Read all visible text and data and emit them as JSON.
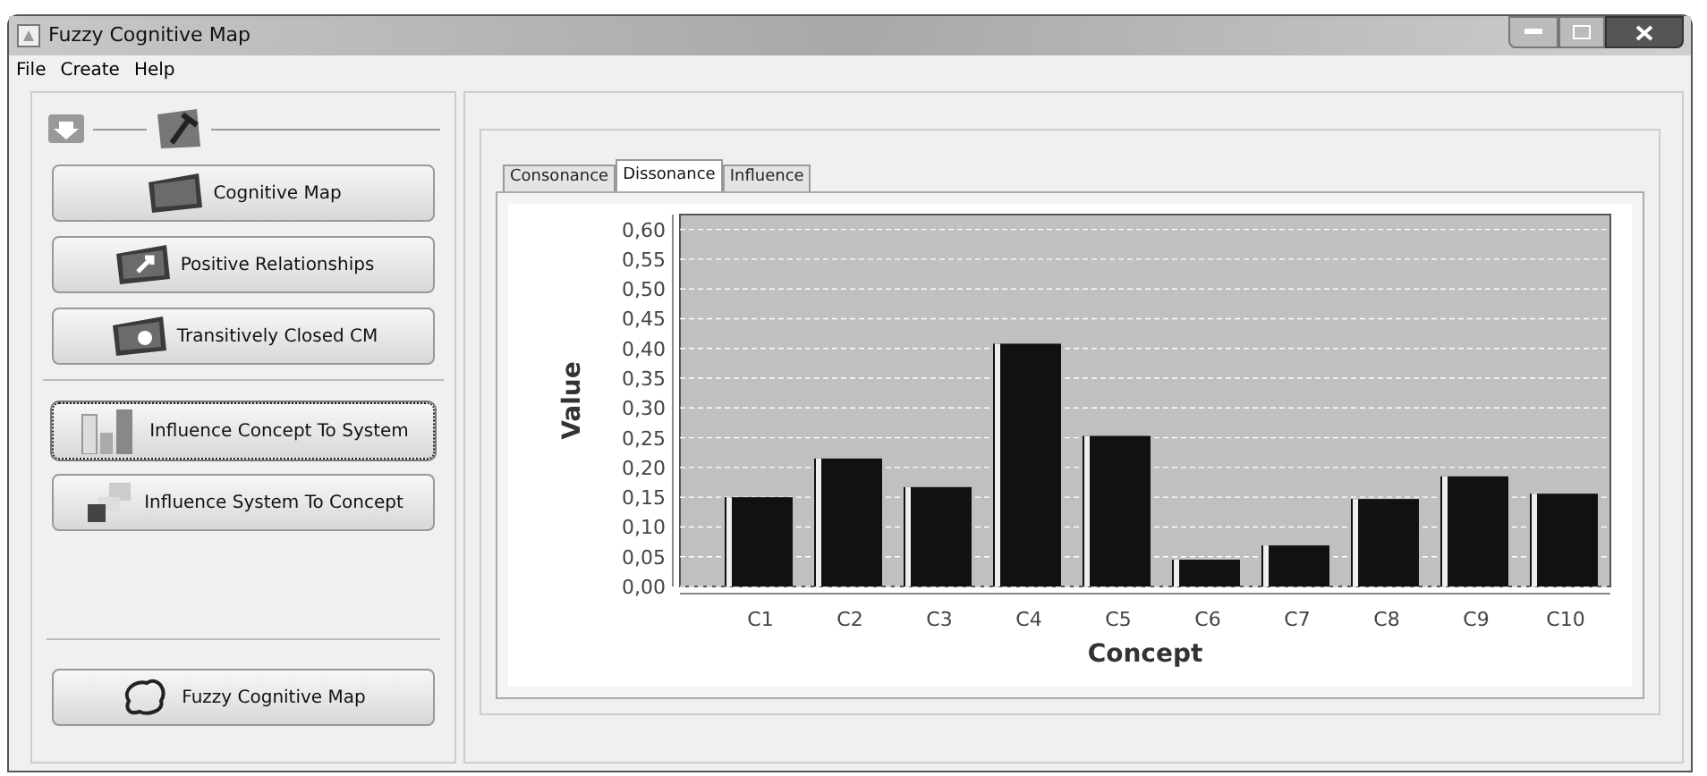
{
  "window": {
    "title": "Fuzzy Cognitive Map"
  },
  "menu": [
    "File",
    "Create",
    "Help"
  ],
  "sidebar": {
    "buttons": [
      {
        "label": "Cognitive Map",
        "kind": "map",
        "selected": false
      },
      {
        "label": "Positive Relationships",
        "kind": "positive",
        "selected": false
      },
      {
        "label": "Transitively Closed CM",
        "kind": "closed",
        "selected": false
      },
      {
        "label": "Influence Concept To System",
        "kind": "bars",
        "selected": true
      },
      {
        "label": "Influence System To Concept",
        "kind": "cubes",
        "selected": false
      }
    ],
    "footer_button": {
      "label": "Fuzzy Cognitive Map"
    }
  },
  "tabs": [
    {
      "label": "Consonance",
      "selected": false
    },
    {
      "label": "Dissonance",
      "selected": true
    },
    {
      "label": "Influence",
      "selected": false
    }
  ],
  "chart_data": {
    "type": "bar",
    "xlabel": "Concept",
    "ylabel": "Value",
    "categories": [
      "C1",
      "C2",
      "C3",
      "C4",
      "C5",
      "C6",
      "C7",
      "C8",
      "C9",
      "C10"
    ],
    "grid": true,
    "series": [
      {
        "color": "#111111",
        "values": [
          0.15,
          0.215,
          0.167,
          0.408,
          0.253,
          0.045,
          0.069,
          0.147,
          0.185,
          0.156
        ]
      }
    ],
    "ylim": [
      0,
      0.625
    ],
    "yticks": [
      {
        "value": 0,
        "label": "0,00"
      },
      {
        "value": 0.05,
        "label": "0,05"
      },
      {
        "value": 0.1,
        "label": "0,10"
      },
      {
        "value": 0.15,
        "label": "0,15"
      },
      {
        "value": 0.2,
        "label": "0,20"
      },
      {
        "value": 0.25,
        "label": "0,25"
      },
      {
        "value": 0.3,
        "label": "0,30"
      },
      {
        "value": 0.35,
        "label": "0,35"
      },
      {
        "value": 0.4,
        "label": "0,40"
      },
      {
        "value": 0.45,
        "label": "0,45"
      },
      {
        "value": 0.5,
        "label": "0,50"
      },
      {
        "value": 0.55,
        "label": "0,55"
      },
      {
        "value": 0.6,
        "label": "0,60"
      }
    ]
  }
}
